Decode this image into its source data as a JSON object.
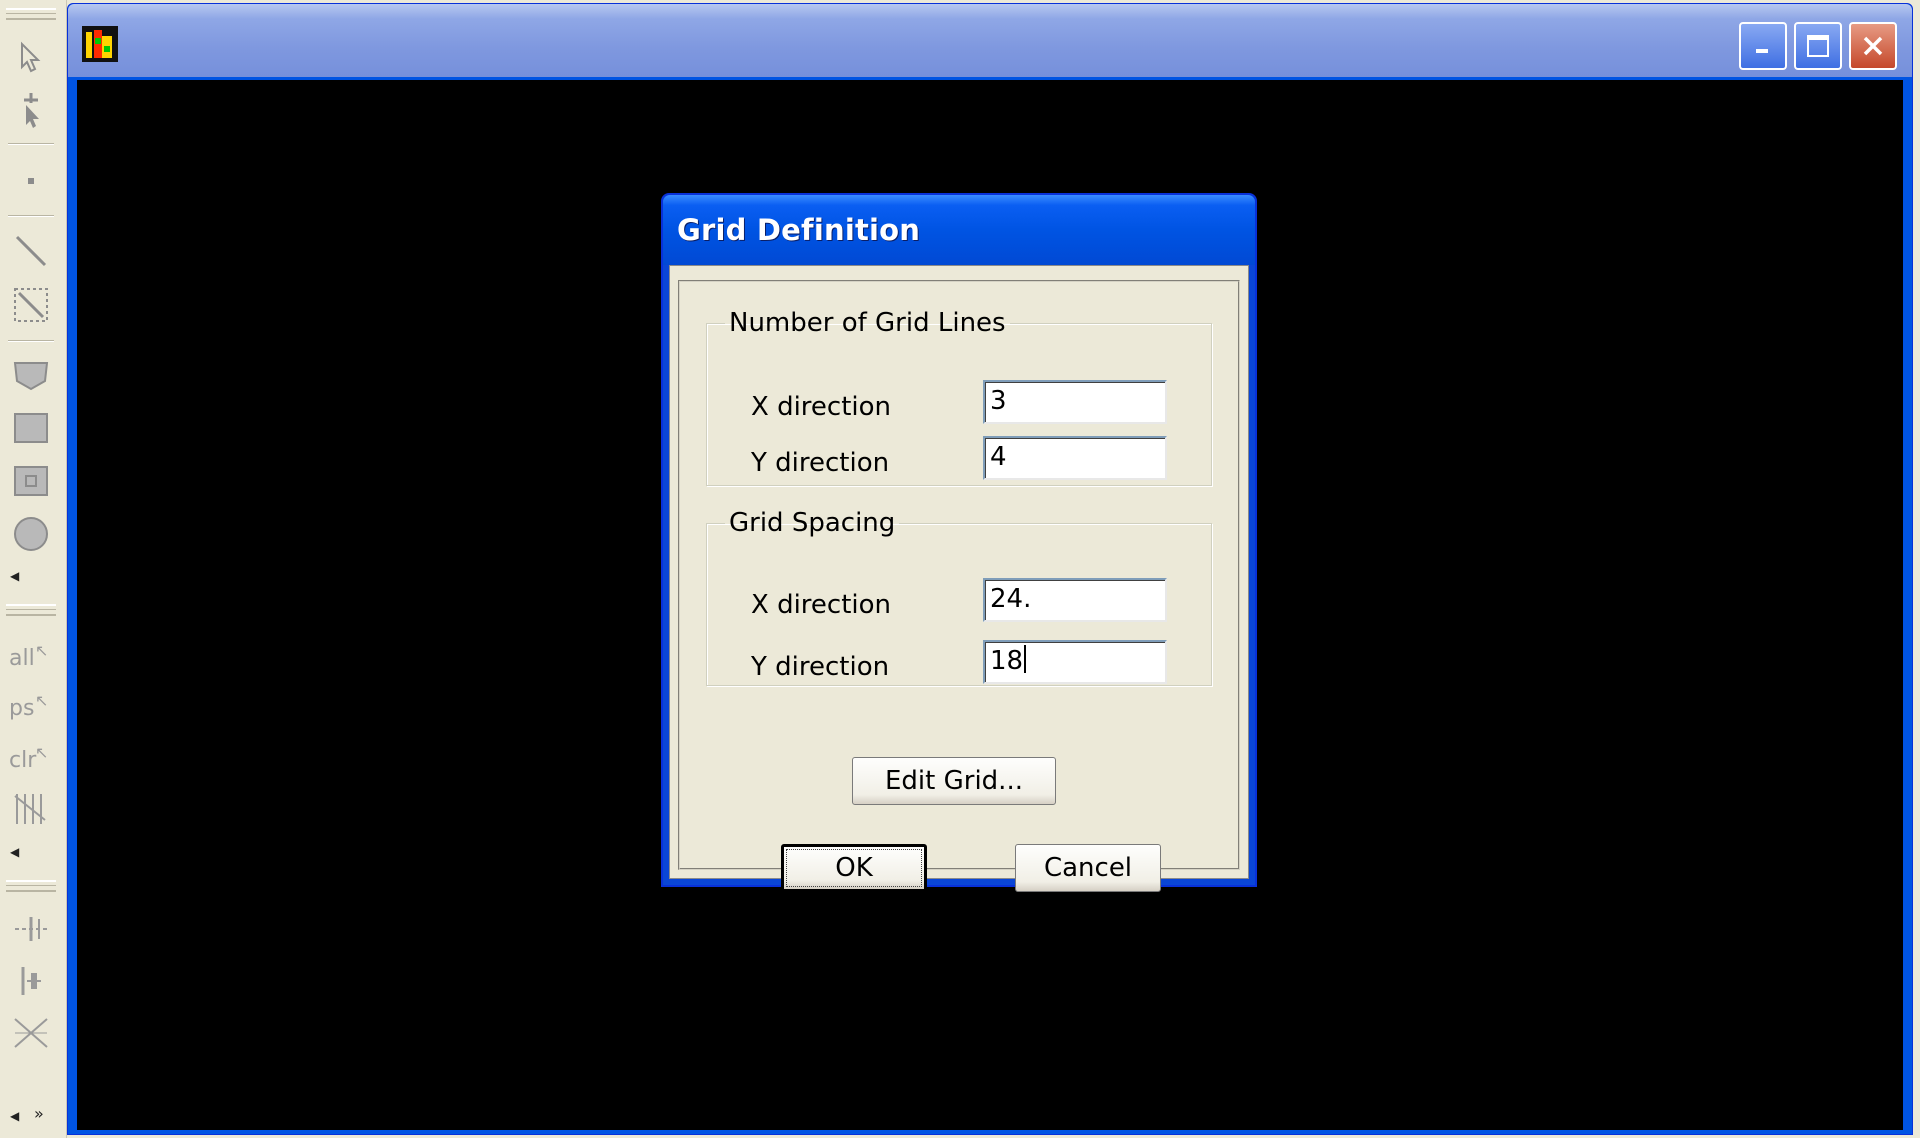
{
  "toolbar": {
    "text_icons": [
      "all",
      "ps",
      "clr"
    ]
  },
  "window": {
    "controls": [
      "minimize",
      "maximize",
      "close"
    ]
  },
  "dialog": {
    "title": "Grid Definition",
    "grid_lines": {
      "legend": "Number of Grid Lines",
      "x_label": "X direction",
      "x_value": "3",
      "y_label": "Y direction",
      "y_value": "4"
    },
    "grid_spacing": {
      "legend": "Grid Spacing",
      "x_label": "X direction",
      "x_value": "24.",
      "y_label": "Y direction",
      "y_value": "18"
    },
    "edit_grid_label": "Edit Grid...",
    "ok_label": "OK",
    "cancel_label": "Cancel"
  },
  "colors": {
    "canvas": "#000000",
    "dialog_title_bar": "#0054e3",
    "dialog_face": "#ece9d8"
  }
}
